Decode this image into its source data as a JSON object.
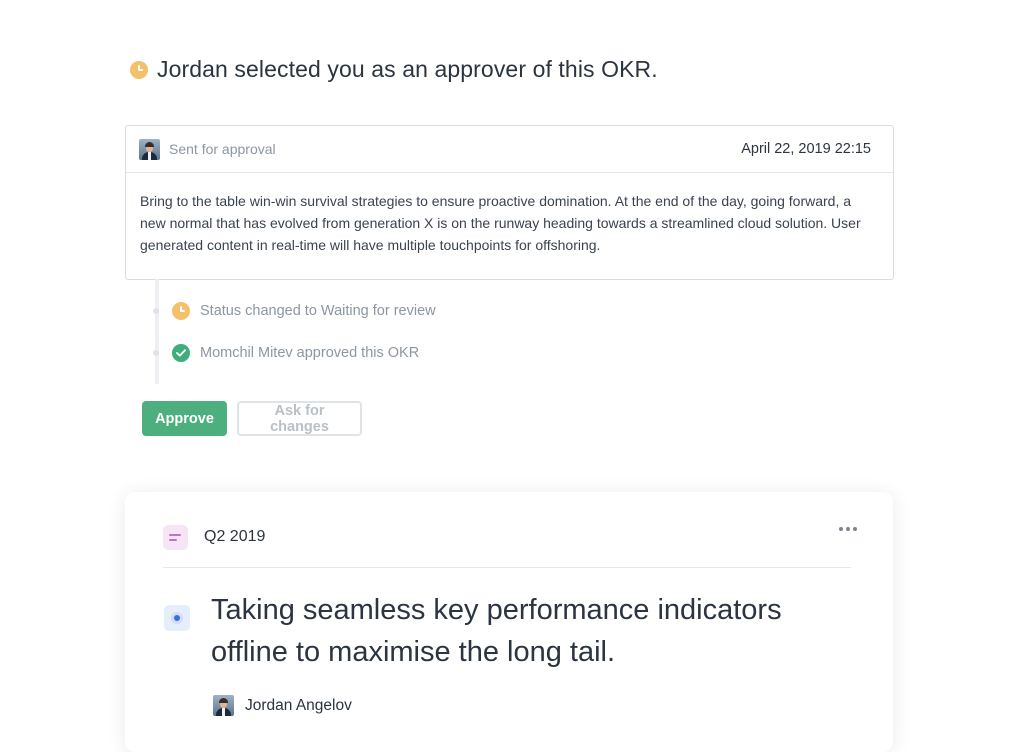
{
  "notice": {
    "text": "Jordan selected you as an approver of this OKR.",
    "icon": "clock-icon"
  },
  "approval": {
    "status_label": "Sent for approval",
    "date": "April 22, 2019 22:15",
    "message": "Bring to the table win-win survival strategies to ensure proactive domination. At the end of the day, going forward, a new normal that has evolved from generation X is on the runway heading towards a streamlined cloud solution. User generated content in real-time will have multiple touchpoints for offshoring."
  },
  "timeline": [
    {
      "icon": "clock-icon",
      "color": "#f5c06a",
      "text": "Status changed to Waiting for review"
    },
    {
      "icon": "check-icon",
      "color": "#3fae7c",
      "text": "Momchil Mitev approved this OKR"
    }
  ],
  "actions": {
    "approve_label": "Approve",
    "changes_label": "Ask for changes"
  },
  "okr": {
    "period": "Q2 2019",
    "title": "Taking seamless key performance indicators offline to maximise the long tail.",
    "owner": "Jordan Angelov"
  },
  "colors": {
    "accent_green": "#4caf7d",
    "pending_orange": "#f5c06a",
    "text_dark": "#2b3440",
    "text_muted": "#8c96a2"
  }
}
